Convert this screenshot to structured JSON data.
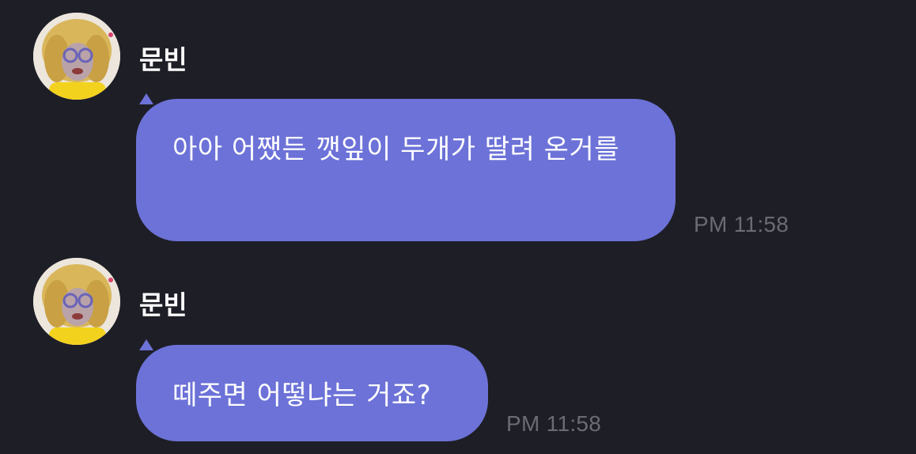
{
  "messages": [
    {
      "sender": "문빈",
      "avatar_icon": "profile-photo-icon",
      "text": "아아 어쨌든 깻잎이 두개가 딸려 온거를",
      "time": "PM 11:58"
    },
    {
      "sender": "문빈",
      "avatar_icon": "profile-photo-icon",
      "text": "떼주면 어떻냐는 거죠?",
      "time": "PM 11:58"
    }
  ],
  "colors": {
    "background": "#1e1e26",
    "bubble": "#6c72d7",
    "timestamp": "#6a6b74"
  }
}
